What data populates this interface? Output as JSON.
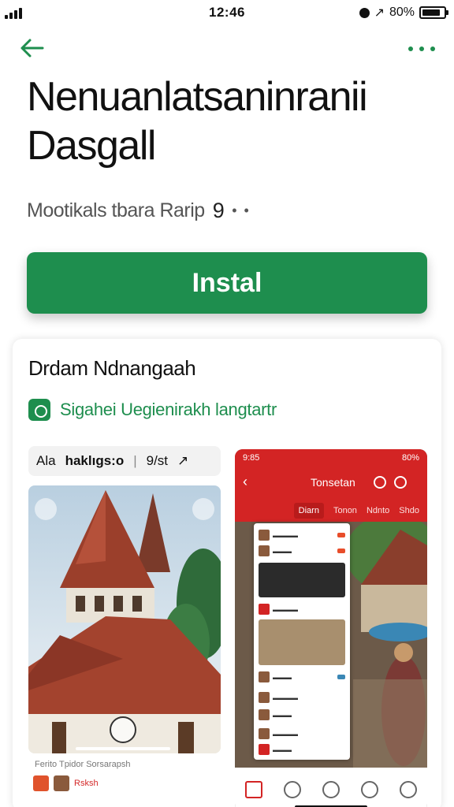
{
  "status_bar": {
    "time": "12:46",
    "battery": "80%"
  },
  "app": {
    "title_line1": "Nenuanlatsaninranii",
    "title_line2": "Dasgall",
    "subtitle": "Mootikals tbara Rarip",
    "rating": "9",
    "install_label": "Instal"
  },
  "card": {
    "title": "Drdam Ndnangaah",
    "tag_label": "Sigahei Uegienirakh langtartr"
  },
  "left_shot": {
    "toolbar_prefix": "Ala",
    "toolbar_bold": "haklıgs:o",
    "toolbar_count": "9/st",
    "caption": "Ferito Tpidor Sorsarapsh",
    "thumb_label": "Rsksh"
  },
  "right_shot": {
    "time": "9:85",
    "battery": "80%",
    "bar_title": "Tonsetan",
    "tabs": [
      "Diarn",
      "Tonon",
      "Ndnto",
      "Shdo"
    ],
    "active_tab": "Diarn"
  },
  "colors": {
    "accent": "#1e8e4e",
    "phone_red": "#d32424"
  },
  "icons": [
    "signal-icon",
    "back-arrow-icon",
    "more-dots-icon",
    "app-tag-icon",
    "share-icon",
    "close-icon"
  ]
}
